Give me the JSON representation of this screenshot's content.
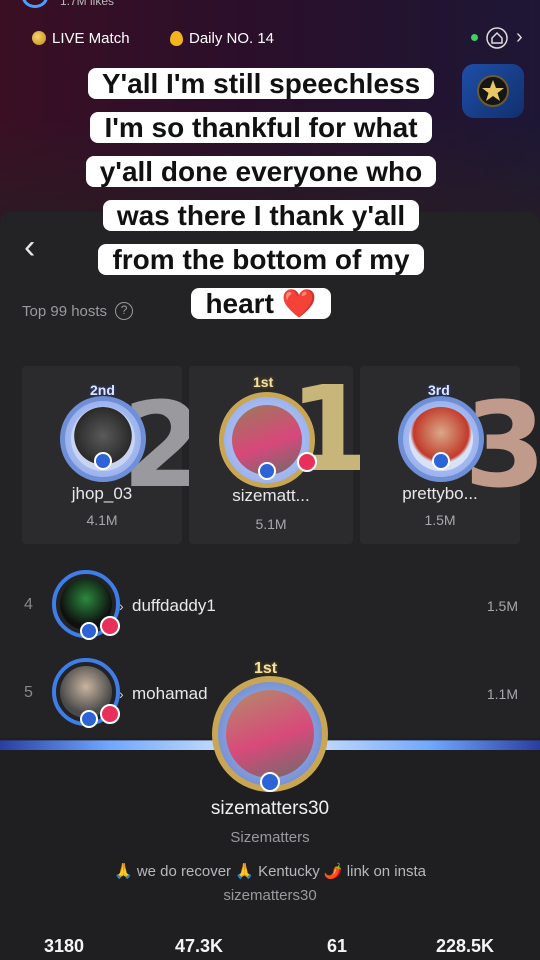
{
  "header": {
    "likes_partial": "1.7M likes",
    "live_match": "LIVE Match",
    "daily": "Daily NO. 14"
  },
  "caption": {
    "lines": [
      "Y'all I'm still speechless",
      "I'm so thankful for what",
      "y'all done everyone who",
      "was there I thank y'all",
      "from the bottom of my",
      "heart ❤️"
    ]
  },
  "panel": {
    "back": "‹",
    "top_hosts_label": "Top 99 hosts",
    "help": "?"
  },
  "podium": [
    {
      "rank_digit": "2",
      "crown": "2nd",
      "name": "jhop_03",
      "count": "4.1M"
    },
    {
      "rank_digit": "1",
      "crown": "1st",
      "name": "sizematt...",
      "count": "5.1M"
    },
    {
      "rank_digit": "3",
      "crown": "3rd",
      "name": "prettybo...",
      "count": "1.5M"
    }
  ],
  "list": [
    {
      "rank": "4",
      "name": "duffdaddy1",
      "count": "1.5M"
    },
    {
      "rank": "5",
      "name": "mohamad",
      "count": "1.1M"
    }
  ],
  "profile": {
    "crown": "1st",
    "username": "sizematters30",
    "nickname": "Sizematters",
    "bio": "🙏 we do recover 🙏 Kentucky 🌶️ link on insta",
    "bio2": "sizematters30",
    "stats": [
      "3180",
      "47.3K",
      "61",
      "228.5K"
    ]
  },
  "colors": {
    "accent_gold": "#c9a653",
    "accent_blue": "#3f7ee8",
    "live_red": "#e8305a"
  }
}
